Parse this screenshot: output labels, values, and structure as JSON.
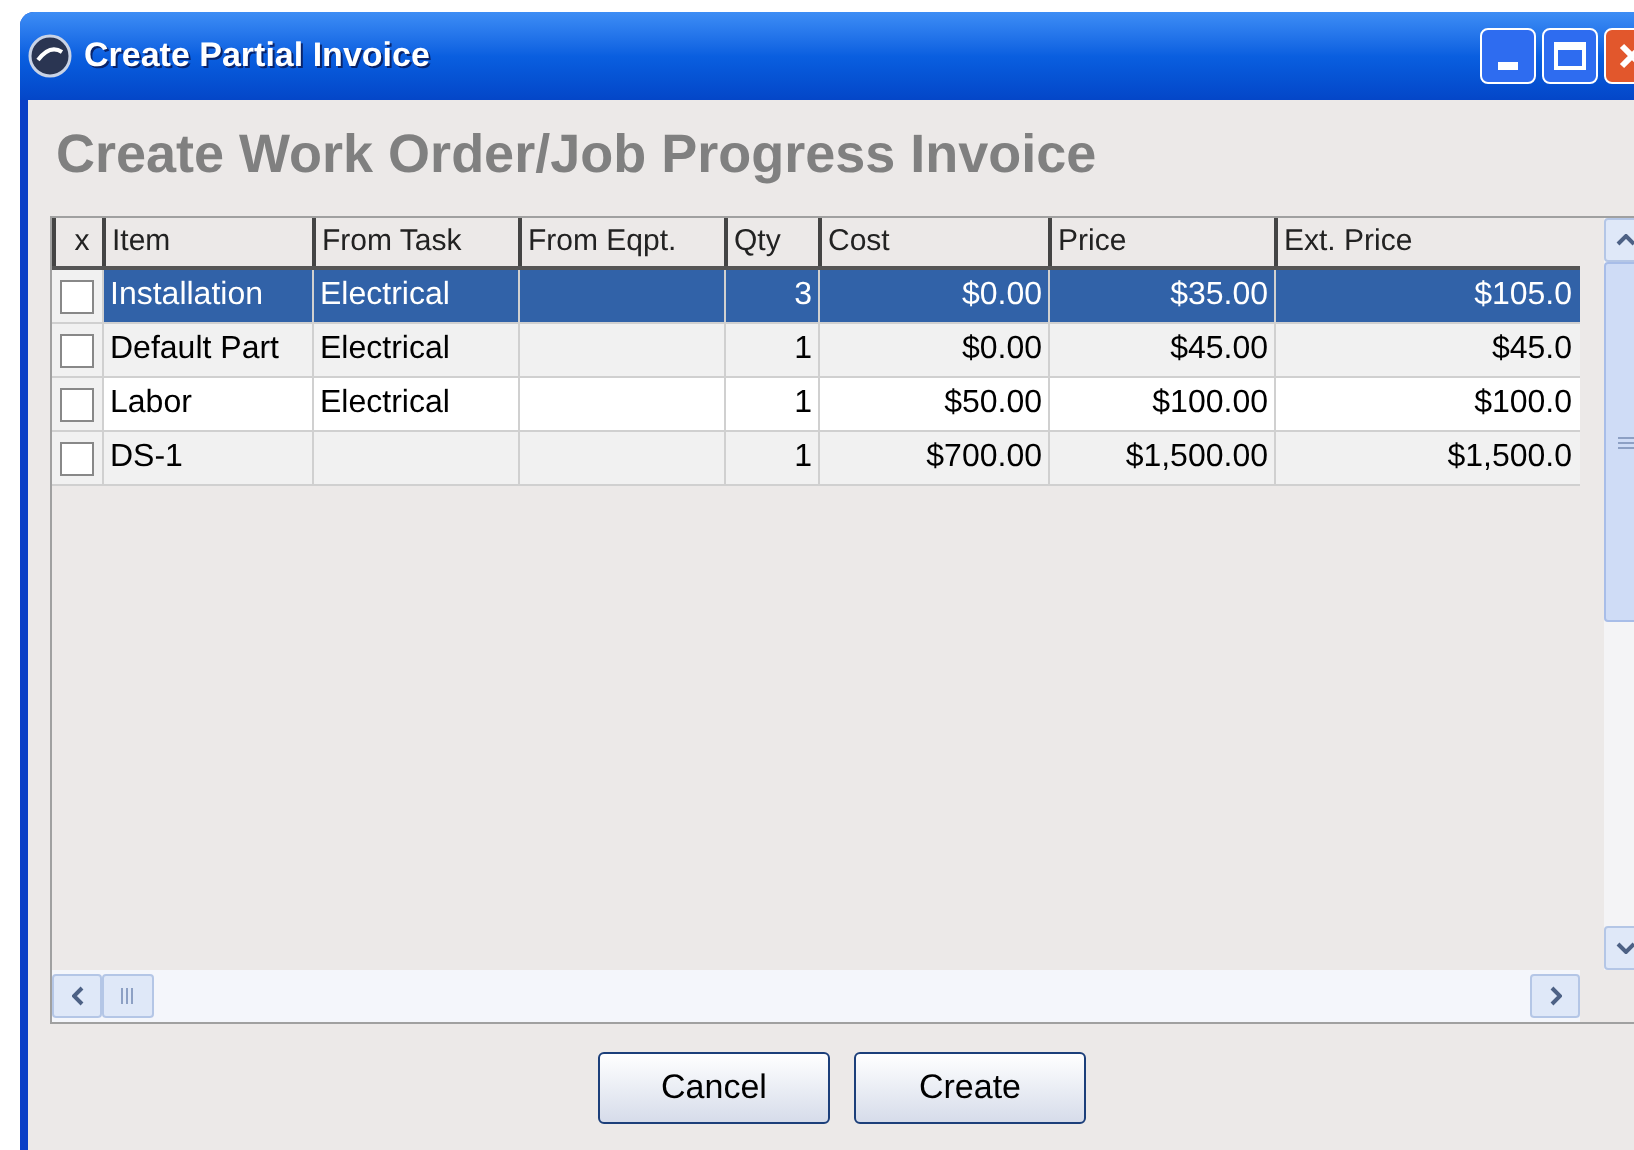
{
  "window": {
    "title": "Create Partial Invoice"
  },
  "heading": "Create Work Order/Job Progress Invoice",
  "table": {
    "columns": [
      "x",
      "Item",
      "From Task",
      "From Eqpt.",
      "Qty",
      "Cost",
      "Price",
      "Ext. Price"
    ],
    "rows": [
      {
        "selected": true,
        "checked": false,
        "cells": [
          "",
          "Installation",
          "Electrical",
          "",
          "3",
          "$0.00",
          "$35.00",
          "$105.0"
        ]
      },
      {
        "selected": false,
        "checked": false,
        "cells": [
          "",
          "Default Part",
          "Electrical",
          "",
          "1",
          "$0.00",
          "$45.00",
          "$45.0"
        ]
      },
      {
        "selected": false,
        "checked": false,
        "cells": [
          "",
          "Labor",
          "Electrical",
          "",
          "1",
          "$50.00",
          "$100.00",
          "$100.0"
        ]
      },
      {
        "selected": false,
        "checked": false,
        "cells": [
          "",
          "DS-1",
          "",
          "",
          "1",
          "$700.00",
          "$1,500.00",
          "$1,500.0"
        ]
      }
    ]
  },
  "buttons": [
    "Cancel",
    "Create"
  ]
}
